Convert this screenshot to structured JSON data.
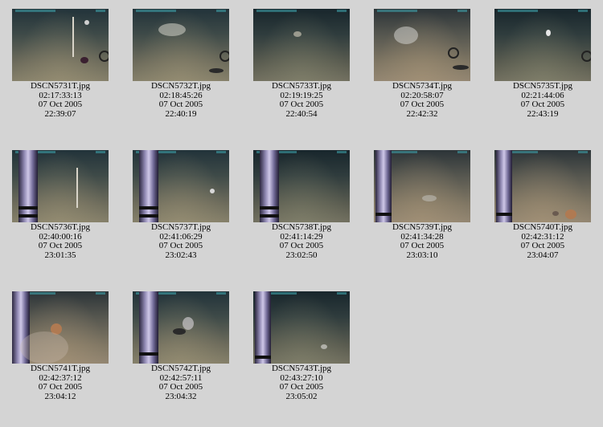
{
  "items": [
    {
      "file": "DSCN5731T.jpg",
      "timecode": "02:17:33:13",
      "date": "07 Oct 2005",
      "time": "22:39:07"
    },
    {
      "file": "DSCN5732T.jpg",
      "timecode": "02:18:45:26",
      "date": "07 Oct 2005",
      "time": "22:40:19"
    },
    {
      "file": "DSCN5733T.jpg",
      "timecode": "02:19:19:25",
      "date": "07 Oct 2005",
      "time": "22:40:54"
    },
    {
      "file": "DSCN5734T.jpg",
      "timecode": "02:20:58:07",
      "date": "07 Oct 2005",
      "time": "22:42:32"
    },
    {
      "file": "DSCN5735T.jpg",
      "timecode": "02:21:44:06",
      "date": "07 Oct 2005",
      "time": "22:43:19"
    },
    {
      "file": "DSCN5736T.jpg",
      "timecode": "02:40:00:16",
      "date": "07 Oct 2005",
      "time": "23:01:35"
    },
    {
      "file": "DSCN5737T.jpg",
      "timecode": "02:41:06:29",
      "date": "07 Oct 2005",
      "time": "23:02:43"
    },
    {
      "file": "DSCN5738T.jpg",
      "timecode": "02:41:14:29",
      "date": "07 Oct 2005",
      "time": "23:02:50"
    },
    {
      "file": "DSCN5739T.jpg",
      "timecode": "02:41:34:28",
      "date": "07 Oct 2005",
      "time": "23:03:10"
    },
    {
      "file": "DSCN5740T.jpg",
      "timecode": "02:42:31:12",
      "date": "07 Oct 2005",
      "time": "23:04:07"
    },
    {
      "file": "DSCN5741T.jpg",
      "timecode": "02:42:37:12",
      "date": "07 Oct 2005",
      "time": "23:04:12"
    },
    {
      "file": "DSCN5742T.jpg",
      "timecode": "02:42:57:11",
      "date": "07 Oct 2005",
      "time": "23:04:32"
    },
    {
      "file": "DSCN5743T.jpg",
      "timecode": "02:43:27:10",
      "date": "07 Oct 2005",
      "time": "23:05:02"
    }
  ],
  "colors": {
    "background": "#d4d4d4",
    "overlay_text": "#3fa7b0",
    "pole": "#8f88b2"
  }
}
